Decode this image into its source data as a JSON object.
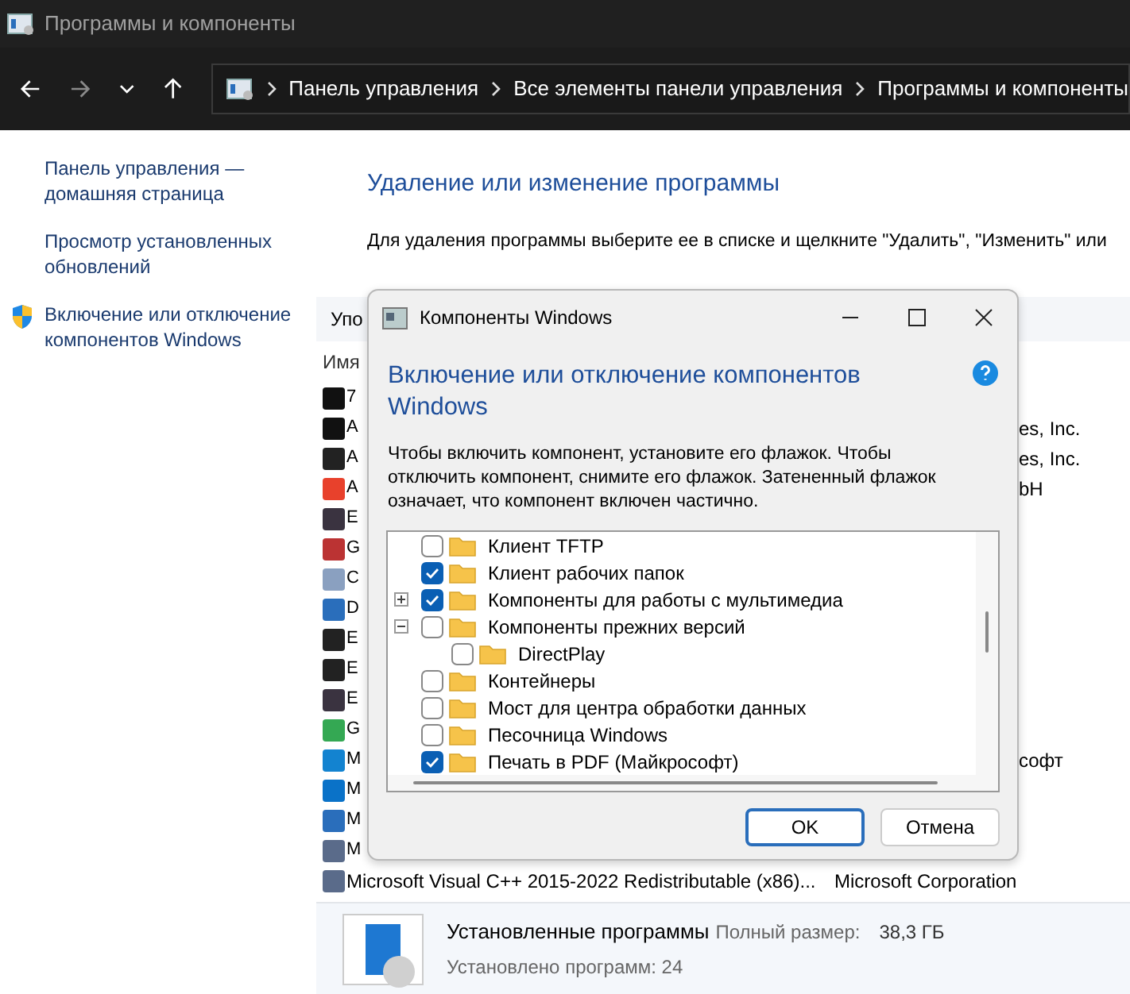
{
  "window": {
    "title": "Программы и компоненты"
  },
  "breadcrumb": [
    "Панель управления",
    "Все элементы панели управления",
    "Программы и компоненты"
  ],
  "sidebar": {
    "items": [
      {
        "label": "Панель управления — домашняя страница",
        "kind": "link"
      },
      {
        "label": "Просмотр установленных обновлений",
        "kind": "link"
      },
      {
        "label": "Включение или отключение компонентов Windows",
        "kind": "shield_link"
      }
    ]
  },
  "main": {
    "title": "Удаление или изменение программы",
    "description": "Для удаления программы выберите ее в списке и щелкните \"Удалить\", \"Изменить\" или"
  },
  "toolbar": {
    "label": "Упо"
  },
  "table": {
    "columns": [
      "Имя"
    ],
    "rows": [
      {
        "name": "7",
        "publisher": "",
        "kind": "partly_hidden"
      },
      {
        "name": "A",
        "publisher": "es, Inc.",
        "kind": "partly_hidden"
      },
      {
        "name": "A",
        "publisher": "es, Inc.",
        "kind": "partly_hidden"
      },
      {
        "name": "A",
        "publisher": "bH",
        "kind": "partly_hidden"
      },
      {
        "name": "E",
        "publisher": "",
        "kind": "partly_hidden"
      },
      {
        "name": "G",
        "publisher": "",
        "kind": "partly_hidden"
      },
      {
        "name": "C",
        "publisher": "",
        "kind": "partly_hidden"
      },
      {
        "name": "D",
        "publisher": "",
        "kind": "partly_hidden"
      },
      {
        "name": "E",
        "publisher": "",
        "kind": "partly_hidden"
      },
      {
        "name": "E",
        "publisher": "",
        "kind": "partly_hidden"
      },
      {
        "name": "E",
        "publisher": "",
        "kind": "partly_hidden"
      },
      {
        "name": "G",
        "publisher": "",
        "kind": "partly_hidden"
      },
      {
        "name": "M",
        "publisher": "софт",
        "kind": "partly_hidden"
      },
      {
        "name": "M",
        "publisher": "",
        "kind": "partly_hidden"
      },
      {
        "name": "M",
        "publisher": "",
        "kind": "partly_hidden"
      },
      {
        "name": "M",
        "publisher": "",
        "kind": "partly_hidden"
      },
      {
        "name": "Microsoft Visual C++ 2015-2022 Redistributable (x86)...",
        "publisher": "Microsoft Corporation",
        "kind": "full"
      }
    ]
  },
  "details": {
    "title": "Установленные программы",
    "size_label": "Полный размер:",
    "size": "38,3 ГБ",
    "count": "Установлено программ: 24"
  },
  "dialog": {
    "title": "Компоненты Windows",
    "heading": "Включение или отключение компонентов Windows",
    "description": "Чтобы включить компонент, установите его флажок. Чтобы отключить компонент, снимите его флажок. Затененный флажок означает, что компонент включен частично.",
    "features": [
      {
        "label": "Клиент TFTP",
        "checked": false
      },
      {
        "label": "Клиент рабочих папок",
        "checked": true
      },
      {
        "label": "Компоненты для работы с мультимедиа",
        "checked": true,
        "expanded": false
      },
      {
        "label": "Компоненты прежних версий",
        "checked": false,
        "expanded": true,
        "children": [
          {
            "label": "DirectPlay",
            "checked": false
          }
        ]
      },
      {
        "label": "Контейнеры",
        "checked": false
      },
      {
        "label": "Мост для центра обработки данных",
        "checked": false
      },
      {
        "label": "Песочница Windows",
        "checked": false
      },
      {
        "label": "Печать в PDF (Майкрософт)",
        "checked": true
      }
    ],
    "buttons": [
      {
        "label": "OK",
        "kind": "primary"
      },
      {
        "label": "Отмена",
        "kind": "secondary"
      }
    ]
  }
}
